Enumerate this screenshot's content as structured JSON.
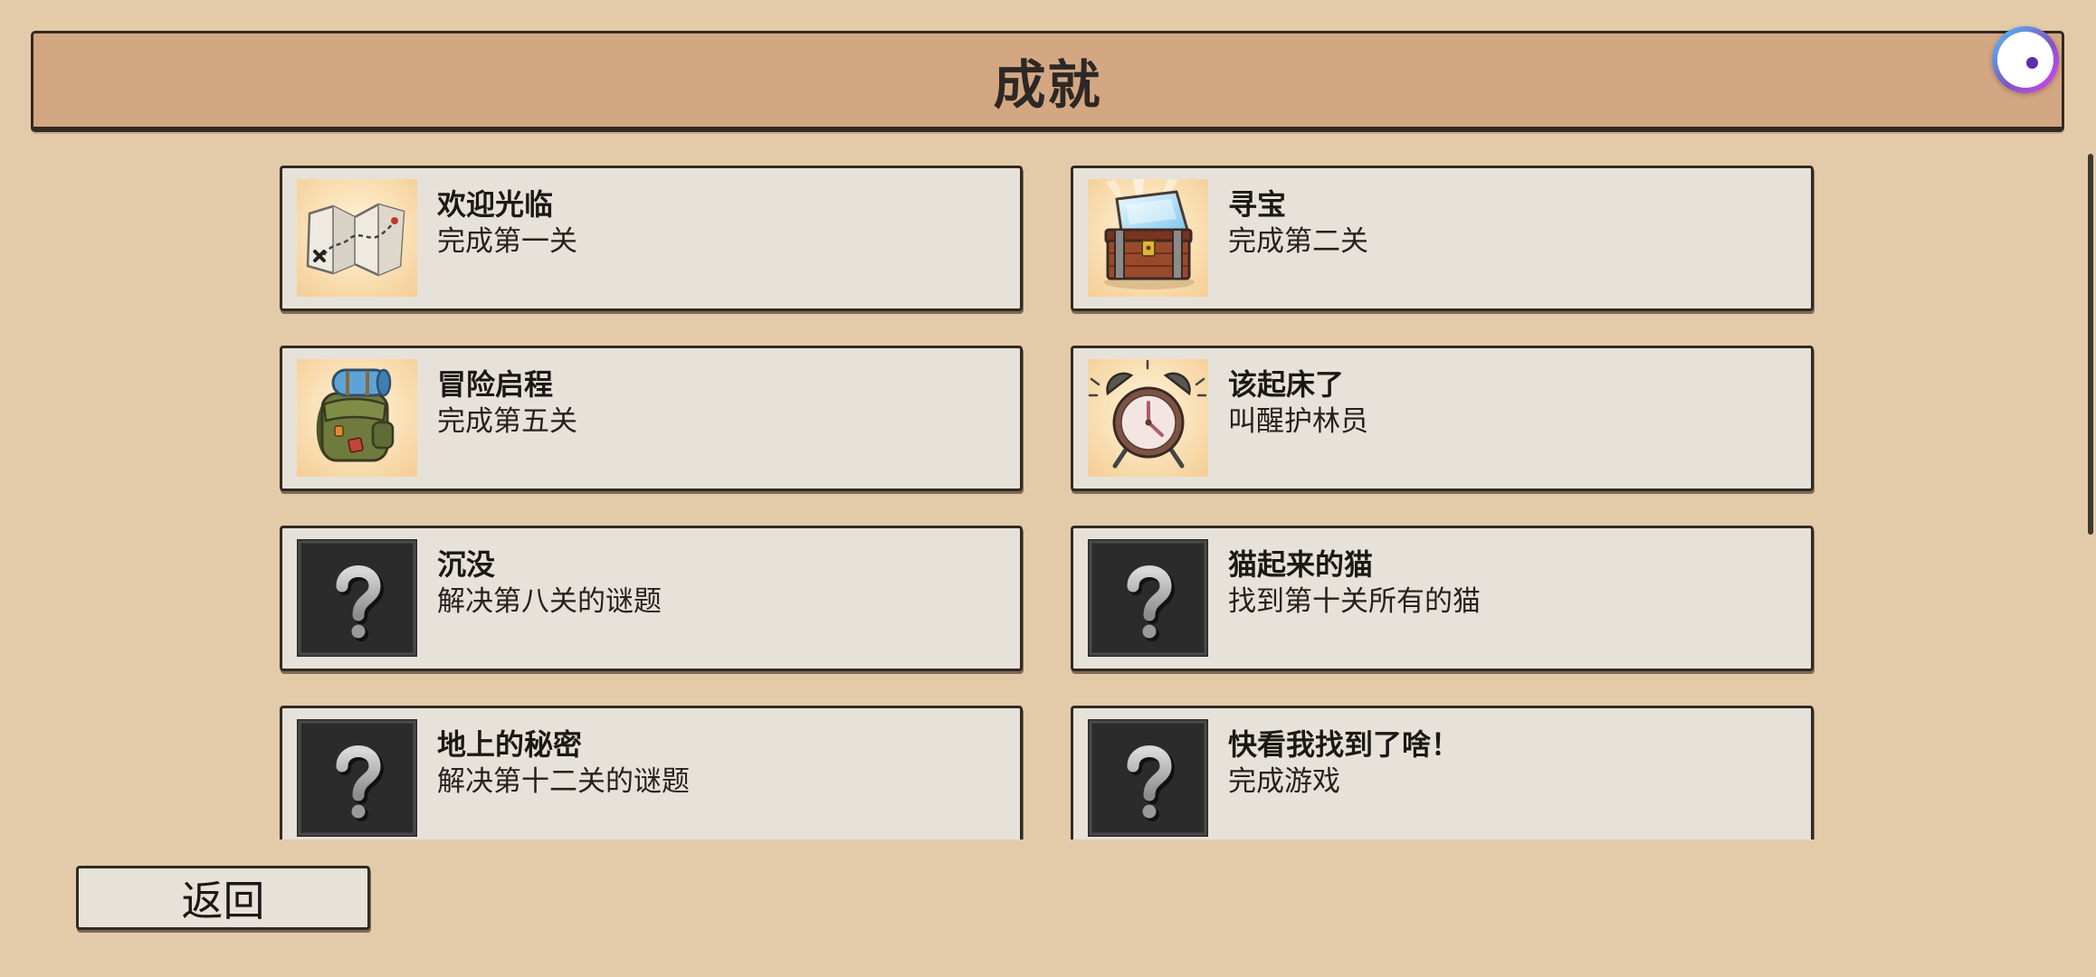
{
  "header": {
    "title": "成就"
  },
  "achievements": [
    {
      "title": "欢迎光临",
      "desc": "完成第一关",
      "icon": "map-icon",
      "locked": false
    },
    {
      "title": "寻宝",
      "desc": "完成第二关",
      "icon": "treasure-chest-icon",
      "locked": false
    },
    {
      "title": "冒险启程",
      "desc": "完成第五关",
      "icon": "backpack-icon",
      "locked": false
    },
    {
      "title": "该起床了",
      "desc": "叫醒护林员",
      "icon": "alarm-clock-icon",
      "locked": false
    },
    {
      "title": "沉没",
      "desc": "解决第八关的谜题",
      "icon": "question-mark-icon",
      "locked": true
    },
    {
      "title": "猫起来的猫",
      "desc": "找到第十关所有的猫",
      "icon": "question-mark-icon",
      "locked": true
    },
    {
      "title": "地上的秘密",
      "desc": "解决第十二关的谜题",
      "icon": "question-mark-icon",
      "locked": true
    },
    {
      "title": "快看我找到了啥！",
      "desc": "完成游戏",
      "icon": "question-mark-icon",
      "locked": true
    }
  ],
  "back_button": {
    "label": "返回"
  },
  "overlay": {
    "floating_button_icon": "assistant-bubble-icon"
  },
  "colors": {
    "background": "#e3cbaa",
    "header": "#d4a783",
    "card": "#e7e2d9",
    "outline": "#332a22",
    "locked_icon_bg": "#2b2b2b"
  }
}
